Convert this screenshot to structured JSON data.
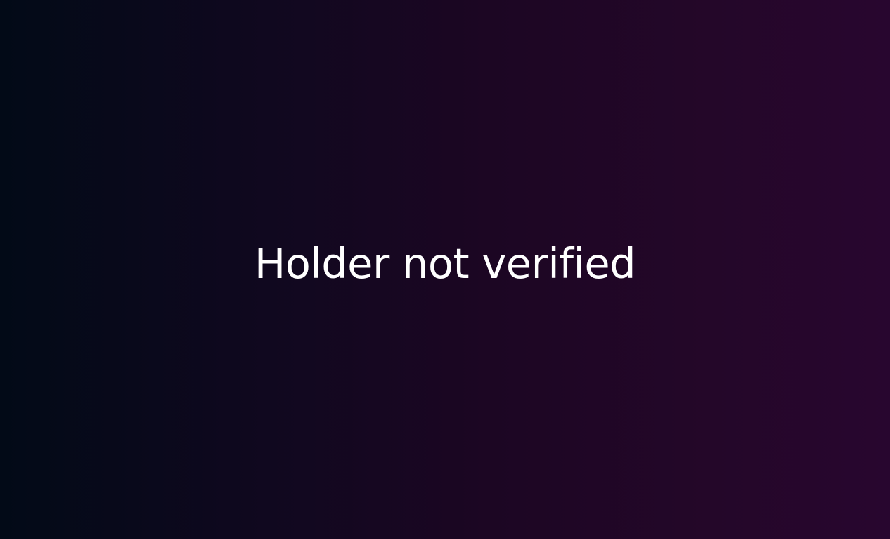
{
  "status": {
    "message": "Holder not verified"
  }
}
